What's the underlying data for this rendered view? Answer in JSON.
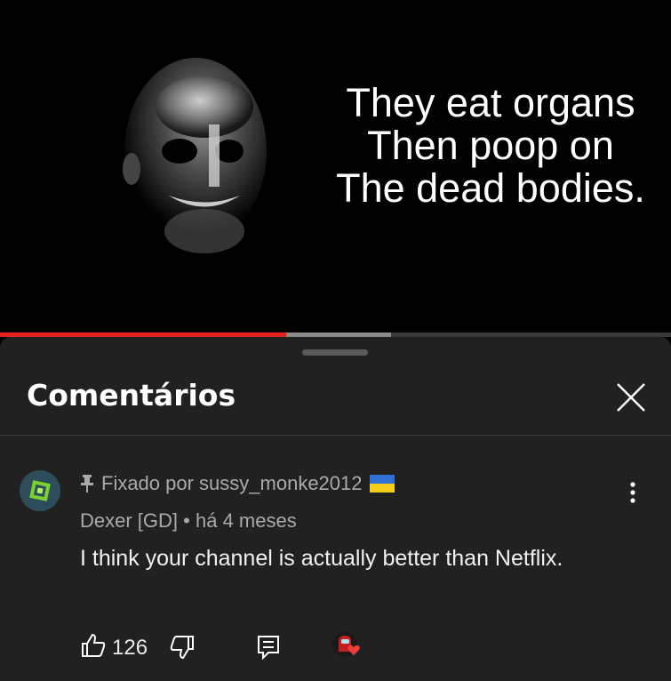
{
  "video": {
    "caption_lines": [
      "They eat organs",
      "Then poop on",
      "The dead bodies."
    ],
    "progress_played": 0.427,
    "progress_buffered": 0.583
  },
  "comments_sheet": {
    "title": "Comentários",
    "close_icon": "close-icon"
  },
  "comment": {
    "pinned_label": "Fixado por sussy_monke2012",
    "pin_icon": "pin-icon",
    "flag_icon": "ukraine-flag-icon",
    "author": "Dexer [GD]",
    "separator": "•",
    "time": "há 4 meses",
    "text": "I think your channel is actually better than Netflix.",
    "like_count": "126",
    "icons": [
      "like-icon",
      "dislike-icon",
      "reply-icon",
      "creator-heart-icon",
      "more-vert-icon"
    ]
  },
  "colors": {
    "progress_red": "#e3221b",
    "sheet_bg": "#212121",
    "secondary_text": "#aaaaaa"
  }
}
